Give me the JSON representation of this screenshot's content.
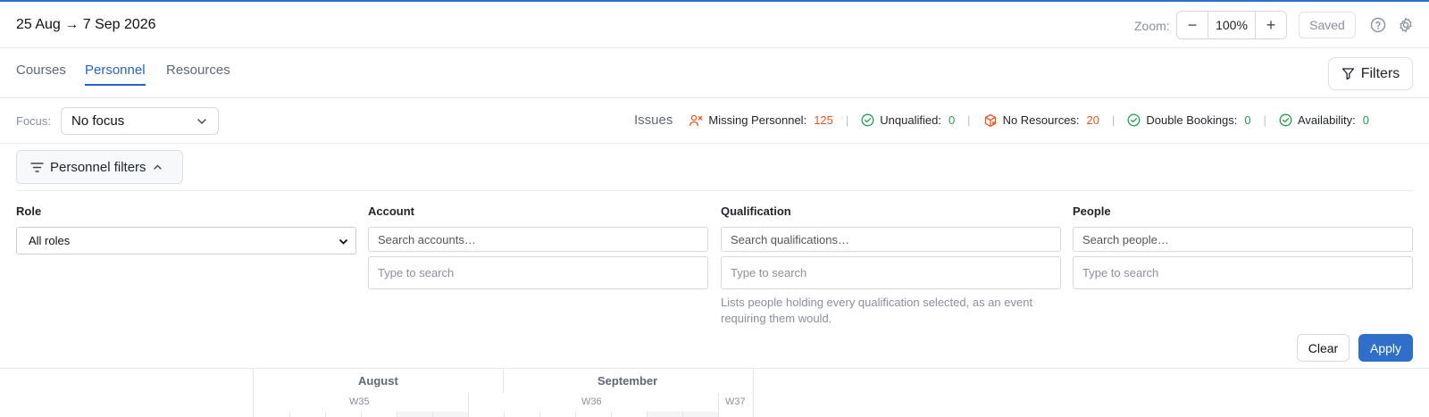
{
  "header": {
    "date_range": "25 Aug → 7 Sep 2026",
    "zoom_label": "Zoom:",
    "zoom_value": "100%",
    "zoom_out": "−",
    "zoom_in": "+",
    "saved_label": "Saved",
    "icons": [
      "help-circle-icon",
      "gear-icon"
    ]
  },
  "tabs": [
    {
      "label": "Courses",
      "active": false
    },
    {
      "label": "Personnel",
      "active": true
    },
    {
      "label": "Resources",
      "active": false
    }
  ],
  "filters_button": "Filters",
  "focus": {
    "label": "Focus:",
    "value": "No focus"
  },
  "issues": {
    "label": "Issues",
    "items": [
      {
        "label": "Missing Personnel:",
        "value": "125",
        "icon": "person-x-icon"
      },
      {
        "label": "Unqualified:",
        "value": "0",
        "icon": "check-circle-icon"
      },
      {
        "label": "No Resources:",
        "value": "20",
        "icon": "package-x-icon"
      },
      {
        "label": "Double Bookings:",
        "value": "0",
        "icon": "check-circle-icon"
      },
      {
        "label": "Availability:",
        "value": "0",
        "icon": "check-circle-icon"
      }
    ],
    "colors": {
      "warning": "#e8571c",
      "ok": "#20a04a"
    }
  },
  "personnel_filters": {
    "toggle_label": "Personnel filters",
    "role": {
      "label": "Role",
      "value": "All roles"
    },
    "account": {
      "label": "Account",
      "search_placeholder": "Search accounts…",
      "type_placeholder": "Type to search"
    },
    "qualification": {
      "label": "Qualification",
      "search_placeholder": "Search qualifications…",
      "type_placeholder": "Type to search",
      "hint": "Lists people holding every qualification selected, as an event requiring them would."
    },
    "people": {
      "label": "People",
      "search_placeholder": "Search people…",
      "type_placeholder": "Type to search"
    },
    "clear_label": "Clear",
    "apply_label": "Apply"
  },
  "timeline": {
    "months": [
      "August",
      "September"
    ],
    "weeks": [
      "W35",
      "W36",
      "W37"
    ]
  },
  "colors": {
    "accent": "#2563c8",
    "apply": "#2f6fc9"
  }
}
